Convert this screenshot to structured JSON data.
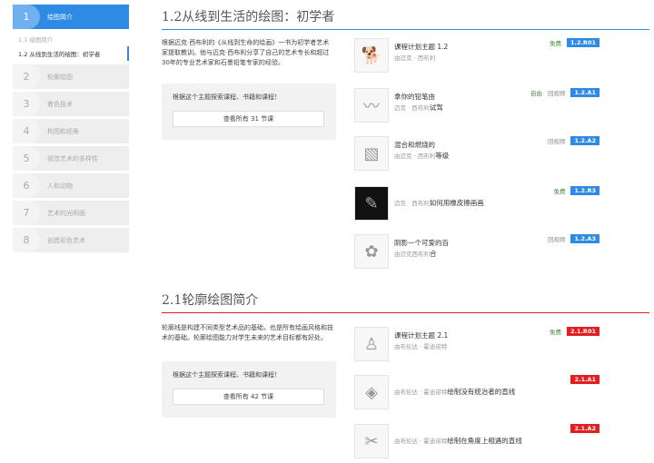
{
  "sidebar": {
    "active": {
      "num": "1",
      "label": "绘图简介"
    },
    "subs": [
      "1.1 绘图简介",
      "1.2 从线到生活的绘图：初学者"
    ],
    "items": [
      {
        "num": "2",
        "label": "轮廓绘图"
      },
      {
        "num": "3",
        "label": "着色技术"
      },
      {
        "num": "4",
        "label": "构图和视角"
      },
      {
        "num": "5",
        "label": "视觉艺术的多样性"
      },
      {
        "num": "6",
        "label": "人和动物"
      },
      {
        "num": "7",
        "label": "艺术的光明面"
      },
      {
        "num": "8",
        "label": "创造彩色艺术"
      }
    ]
  },
  "sections": [
    {
      "title": "1.2从线到生活的绘图：初学者",
      "color": "#2f8ae5",
      "desc": "根据迈克·西布利的《从线到生命的绘画》一书为初学者艺术家提取教训。他与迈克·西布利分享了自己的艺术专长和超过30年的专业艺术家和石墨铅笔专家的经验。",
      "explore": "根据这个主题探索课程、书籍和课程！",
      "button": "查看所有 31 节课",
      "lessons": [
        {
          "title": "课程计划主题 1.2",
          "sub": "由迈克 · 西布利",
          "sub_title": "",
          "free": "免费",
          "video": "",
          "code": "1.2.R01",
          "icon": "🐕"
        },
        {
          "title": "拿你的铅笔由",
          "sub": "迈克 · 西布利",
          "sub_title": "试驾",
          "free": "自由",
          "video": "回视频",
          "code": "1.2.A1",
          "icon": "〰"
        },
        {
          "title": "混合和燃烧的",
          "sub": "由迈克 · 西布利",
          "sub_title": "等级",
          "free": "",
          "video": "回视频",
          "code": "1.2.A2",
          "icon": "▧"
        },
        {
          "title": "",
          "sub": "迈克 · 西布利",
          "sub_title": "如何用橡皮擦画画",
          "free": "免费",
          "video": "",
          "code": "1.2.R3",
          "icon": "✎"
        },
        {
          "title": "阴影一个可爱的百",
          "sub": "由迈克西布利",
          "sub_title": "合",
          "free": "",
          "video": "回视频",
          "code": "1.2.A3",
          "icon": "✿"
        }
      ]
    },
    {
      "title": "2.1轮廓绘图简介",
      "color": "#e02020",
      "desc": "轮廓线是构建不同类型艺术品的基础，也是所有绘画风格和技术的基础。轮廓绘图能力对学生未来的艺术目标都有好处。",
      "explore": "根据这个主题探索课程、书籍和课程！",
      "button": "查看所有 42 节课",
      "lessons": [
        {
          "title": "课程计划主题 2.1",
          "sub": "由布伦达 · 霍迪诺特",
          "sub_title": "",
          "free": "免费",
          "video": "",
          "code": "2.1.R01",
          "icon": "♙"
        },
        {
          "title": "",
          "sub": "由布伦达 · 霍迪诺特",
          "sub_title": "绘制没有统治者的直线",
          "free": "",
          "video": "",
          "code": "2.1.A1",
          "icon": "◈"
        },
        {
          "title": "",
          "sub": "由布伦达 · 霍迪诺特",
          "sub_title": "绘制在角度上相遇的直线",
          "free": "",
          "video": "",
          "code": "2.1.A2",
          "icon": "✂"
        }
      ]
    }
  ]
}
